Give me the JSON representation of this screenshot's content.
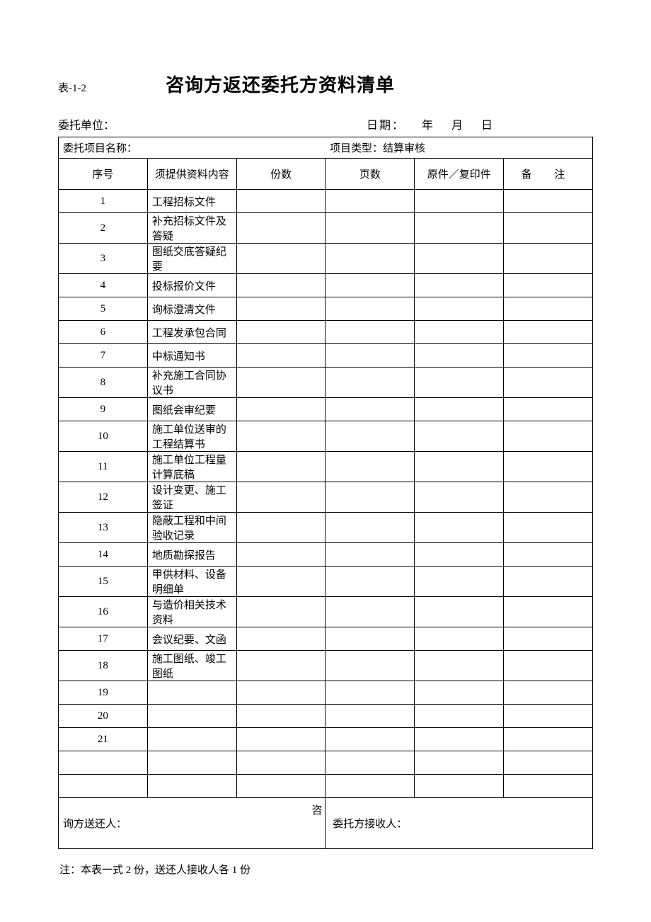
{
  "header": {
    "table_code": "表-1-2",
    "title": "咨询方返还委托方资料清单"
  },
  "meta": {
    "client_label": "委托单位：",
    "date_label": "日期：",
    "date_year_unit": "年",
    "date_month_unit": "月",
    "date_day_unit": "日"
  },
  "top": {
    "project_name_label": "委托项目名称：",
    "project_type_label": "项目类型：结算审核"
  },
  "columns": {
    "seq": "序号",
    "content": "须提供资料内容",
    "copies": "份数",
    "pages": "页数",
    "orig": "原件／复印件",
    "remark": "备  注"
  },
  "rows": [
    {
      "seq": "1",
      "content": "工程招标文件"
    },
    {
      "seq": "2",
      "content": "补充招标文件及答疑"
    },
    {
      "seq": "3",
      "content": "图纸交底答疑纪要"
    },
    {
      "seq": "4",
      "content": "投标报价文件"
    },
    {
      "seq": "5",
      "content": "询标澄清文件"
    },
    {
      "seq": "6",
      "content": "工程发承包合同"
    },
    {
      "seq": "7",
      "content": "中标通知书"
    },
    {
      "seq": "8",
      "content": "补充施工合同协议书"
    },
    {
      "seq": "9",
      "content": "图纸会审纪要"
    },
    {
      "seq": "10",
      "content": "施工单位送审的工程结算书"
    },
    {
      "seq": "11",
      "content": "施工单位工程量计算底稿"
    },
    {
      "seq": "12",
      "content": "设计变更、施工签证"
    },
    {
      "seq": "13",
      "content": "隐蔽工程和中间验收记录"
    },
    {
      "seq": "14",
      "content": "地质勘探报告"
    },
    {
      "seq": "15",
      "content": "甲供材料、设备明细单"
    },
    {
      "seq": "16",
      "content": "与造价相关技术资料"
    },
    {
      "seq": "17",
      "content": "会议纪要、文函"
    },
    {
      "seq": "18",
      "content": "施工图纸、竣工图纸"
    },
    {
      "seq": "19",
      "content": ""
    },
    {
      "seq": "20",
      "content": ""
    },
    {
      "seq": "21",
      "content": ""
    },
    {
      "seq": "",
      "content": ""
    },
    {
      "seq": "",
      "content": ""
    }
  ],
  "signature": {
    "returner_prefix": "咨",
    "returner_label": "询方送还人：",
    "receiver_label": "委托方接收人："
  },
  "footnote": "注：本表一式 2 份，送还人接收人各 1 份"
}
